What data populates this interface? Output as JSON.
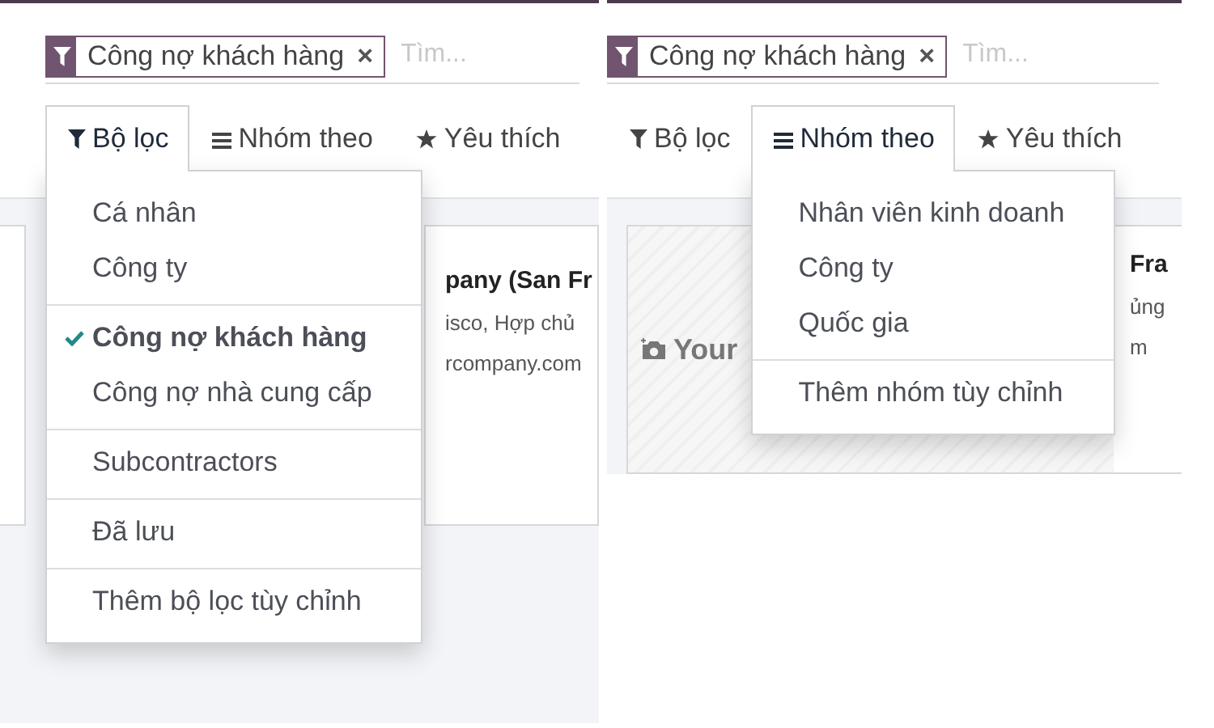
{
  "panels": [
    {
      "facet": {
        "label": "Công nợ khách hàng",
        "remove": "×"
      },
      "search": {
        "placeholder": "Tìm..."
      },
      "tabs": [
        {
          "label": "Bộ lọc",
          "kind": "filter",
          "selected": true
        },
        {
          "label": "Nhóm theo",
          "kind": "group",
          "selected": false
        },
        {
          "label": "Yêu thích",
          "kind": "favorite",
          "selected": false
        }
      ],
      "dropdown": {
        "groups": [
          [
            {
              "label": "Cá nhân",
              "checked": false
            },
            {
              "label": "Công ty",
              "checked": false
            }
          ],
          [
            {
              "label": "Công nợ khách hàng",
              "checked": true
            },
            {
              "label": "Công nợ nhà cung cấp",
              "checked": false
            }
          ],
          [
            {
              "label": "Subcontractors",
              "checked": false
            }
          ],
          [
            {
              "label": "Đã lưu",
              "checked": false
            }
          ],
          [
            {
              "label": "Thêm bộ lọc tùy chỉnh",
              "checked": false
            }
          ]
        ]
      },
      "card": {
        "lines": [
          "pany (San Fr",
          "isco, Hợp chủ",
          "rcompany.com"
        ]
      }
    },
    {
      "facet": {
        "label": "Công nợ khách hàng",
        "remove": "×"
      },
      "search": {
        "placeholder": "Tìm..."
      },
      "tabs": [
        {
          "label": "Bộ lọc",
          "kind": "filter",
          "selected": false
        },
        {
          "label": "Nhóm theo",
          "kind": "group",
          "selected": true
        },
        {
          "label": "Yêu thích",
          "kind": "favorite",
          "selected": false
        }
      ],
      "dropdown": {
        "groups": [
          [
            {
              "label": "Nhân viên kinh doanh",
              "checked": false
            },
            {
              "label": "Công ty",
              "checked": false
            },
            {
              "label": "Quốc gia",
              "checked": false
            }
          ],
          [
            {
              "label": "Thêm nhóm tùy chỉnh",
              "checked": false
            }
          ]
        ]
      },
      "card": {
        "photo_label": "Your",
        "lines": [
          "Fra",
          "ủng",
          "m"
        ]
      }
    }
  ]
}
